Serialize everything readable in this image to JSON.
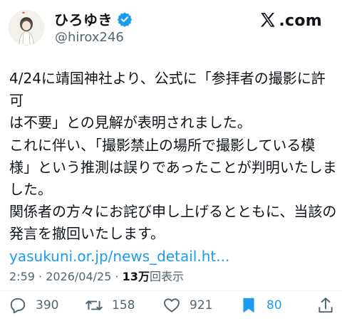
{
  "author": {
    "display_name": "ひろゆき",
    "handle": "@hirox246"
  },
  "brand": {
    "label": ".com"
  },
  "post": {
    "paragraphs": [
      "4/24に靖国神社より、公式に「参拝者の撮影に許可\nは不要」との見解が表明されました。",
      "これに伴い、「撮影禁止の場所で撮影している模\n様」という推測は誤りであったことが判明いたしま\nした。",
      "関係者の方々にお詫び申し上げるとともに、当該の\n発言を撤回いたします。"
    ],
    "link": "yasukuni.or.jp/news_detail.ht..."
  },
  "meta": {
    "timestamp": "2:59 · 2026/04/25 · ",
    "views_count": "13万",
    "views_label": "回表示"
  },
  "actions": {
    "replies": "390",
    "reposts": "158",
    "likes": "921",
    "bookmarks": "80"
  },
  "colors": {
    "accent": "#1d9bf0",
    "text": "#0f1419",
    "secondary": "#536471"
  }
}
